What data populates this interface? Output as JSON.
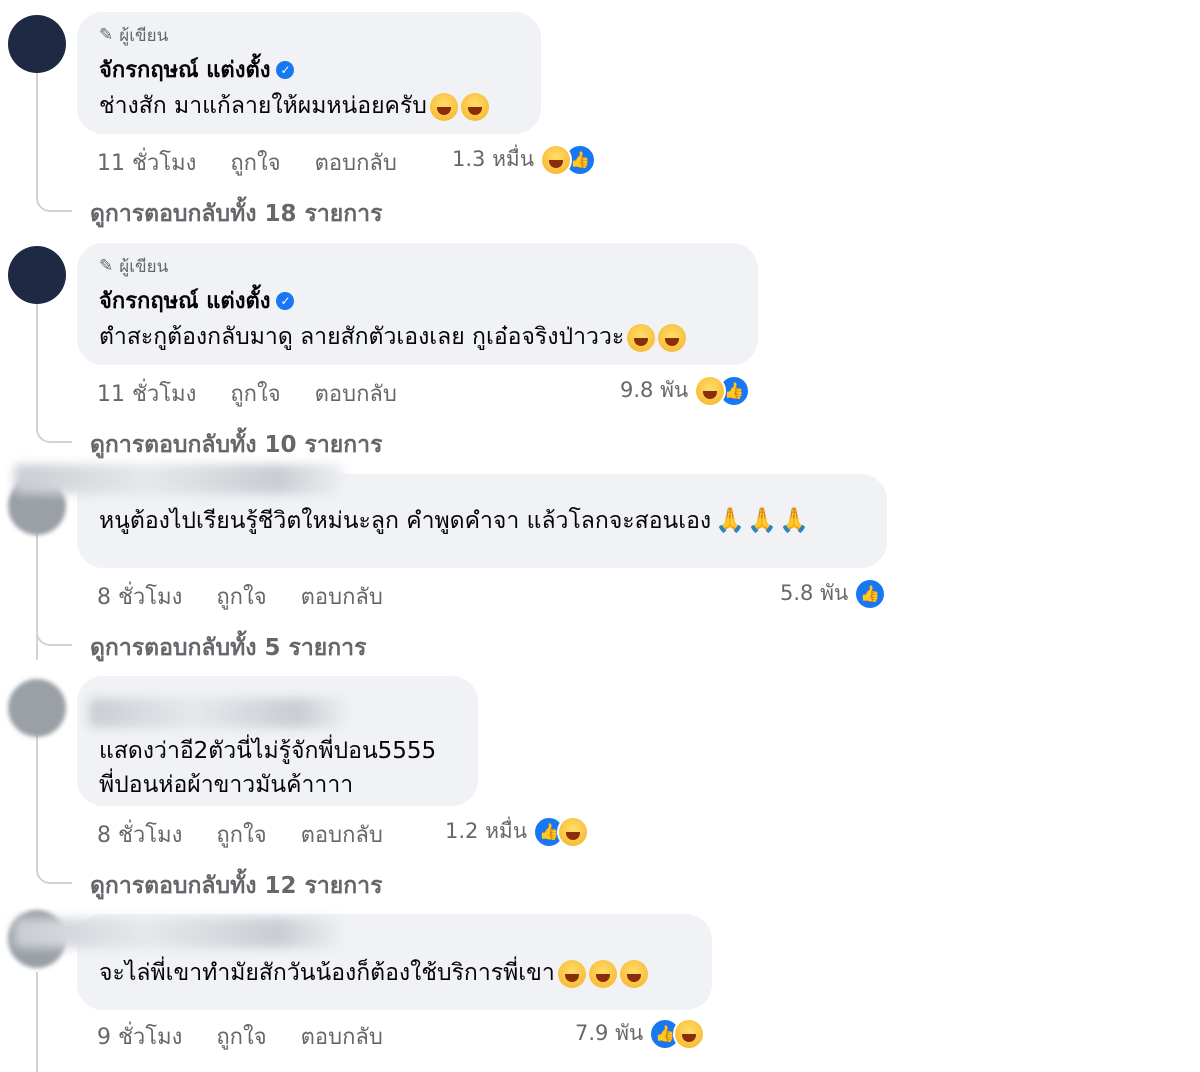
{
  "comments": [
    {
      "role": "ผู้เขียน",
      "name": "จักรกฤษณ์ แต่งตั้ง",
      "text": [
        "ช่างสัก มาแก้ลายให้ผมหน่อยครับ"
      ],
      "time": "11 ชั่วโมง",
      "like_label": "ถูกใจ",
      "reply_label": "ตอบกลับ",
      "reaction_count": "1.3 หมื่น",
      "reactions": [
        "haha-icon",
        "like-icon"
      ],
      "view_replies": "ดูการตอบกลับทั้ง 18 รายการ"
    },
    {
      "role": "ผู้เขียน",
      "name": "จักรกฤษณ์ แต่งตั้ง",
      "text": [
        "ตำสะกูต้องกลับมาดู ลายสักตัวเองเลย กูเอ๋อจริงป่าววะ"
      ],
      "time": "11 ชั่วโมง",
      "like_label": "ถูกใจ",
      "reply_label": "ตอบกลับ",
      "reaction_count": "9.8 พัน",
      "reactions": [
        "haha-icon",
        "like-icon"
      ],
      "view_replies": "ดูการตอบกลับทั้ง 10 รายการ"
    },
    {
      "text": [
        "หนูต้องไปเรียนรู้ชีวิตใหม่นะลูก คำพูดคำจา แล้วโลกจะสอนเอง"
      ],
      "time": "8 ชั่วโมง",
      "like_label": "ถูกใจ",
      "reply_label": "ตอบกลับ",
      "reaction_count": "5.8 พัน",
      "reactions": [
        "like-icon"
      ],
      "view_replies": "ดูการตอบกลับทั้ง 5 รายการ"
    },
    {
      "text": [
        "แสดงว่าอี2ตัวนี่ไม่รู้จักพี่ปอน5555",
        "พี่ปอนห่อผ้าขาวมันค้าาาา"
      ],
      "time": "8 ชั่วโมง",
      "like_label": "ถูกใจ",
      "reply_label": "ตอบกลับ",
      "reaction_count": "1.2 หมื่น",
      "reactions": [
        "like-icon",
        "haha-icon"
      ],
      "view_replies": "ดูการตอบกลับทั้ง 12 รายการ"
    },
    {
      "text": [
        "จะไล่พี่เขาทำมัยสักวันน้องก็ต้องใช้บริการพี่เขา"
      ],
      "time": "9 ชั่วโมง",
      "like_label": "ถูกใจ",
      "reply_label": "ตอบกลับ",
      "reaction_count": "7.9 พัน",
      "reactions": [
        "like-icon",
        "haha-icon"
      ]
    }
  ],
  "colors": {
    "bubble": "#f0f2f5",
    "like_blue": "#1877f2",
    "meta_gray": "#65676b"
  }
}
